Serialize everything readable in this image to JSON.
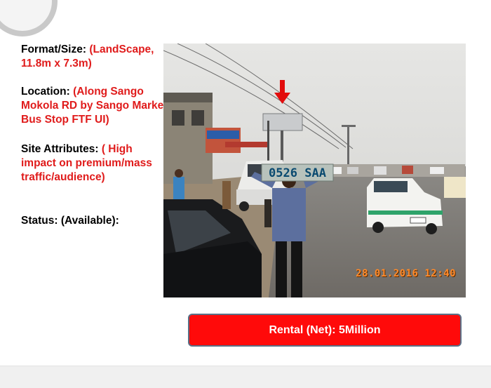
{
  "info": {
    "format_label": "Format/Size: ",
    "format_value": "(LandScape, 11.8m x 7.3m)",
    "location_label": "Location: ",
    "location_value": "(Along Sango Mokola RD by Sango Market Bus Stop FTF UI)",
    "attributes_label": "Site Attributes: ",
    "attributes_value": "( High impact on premium/mass traffic/audience)",
    "status": "Status: (Available):"
  },
  "photo": {
    "timestamp": "28.01.2016 12:40",
    "plate_text": "0526 SAA"
  },
  "cta": {
    "label": "Rental (Net): 5Million"
  },
  "colors": {
    "accent": "#e01b1b",
    "button": "#ff0a0a"
  }
}
